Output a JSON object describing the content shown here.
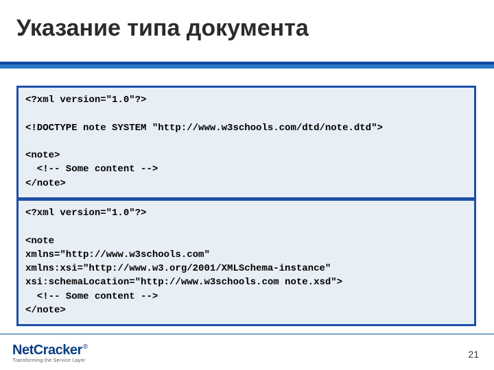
{
  "title": "Указание типа документа",
  "code_box_1": "<?xml version=\"1.0\"?>\n\n<!DOCTYPE note SYSTEM \"http://www.w3schools.com/dtd/note.dtd\">\n\n<note>\n  <!-- Some content -->\n</note>",
  "code_box_2": "<?xml version=\"1.0\"?>\n\n<note\nxmlns=\"http://www.w3schools.com\"\nxmlns:xsi=\"http://www.w3.org/2001/XMLSchema-instance\"\nxsi:schemaLocation=\"http://www.w3schools.com note.xsd\">\n  <!-- Some content -->\n</note>",
  "logo": {
    "brand_part1": "Net",
    "brand_part2": "Cracker",
    "registered": "®",
    "tagline": "Transforming the Service Layer"
  },
  "page_number": "21"
}
